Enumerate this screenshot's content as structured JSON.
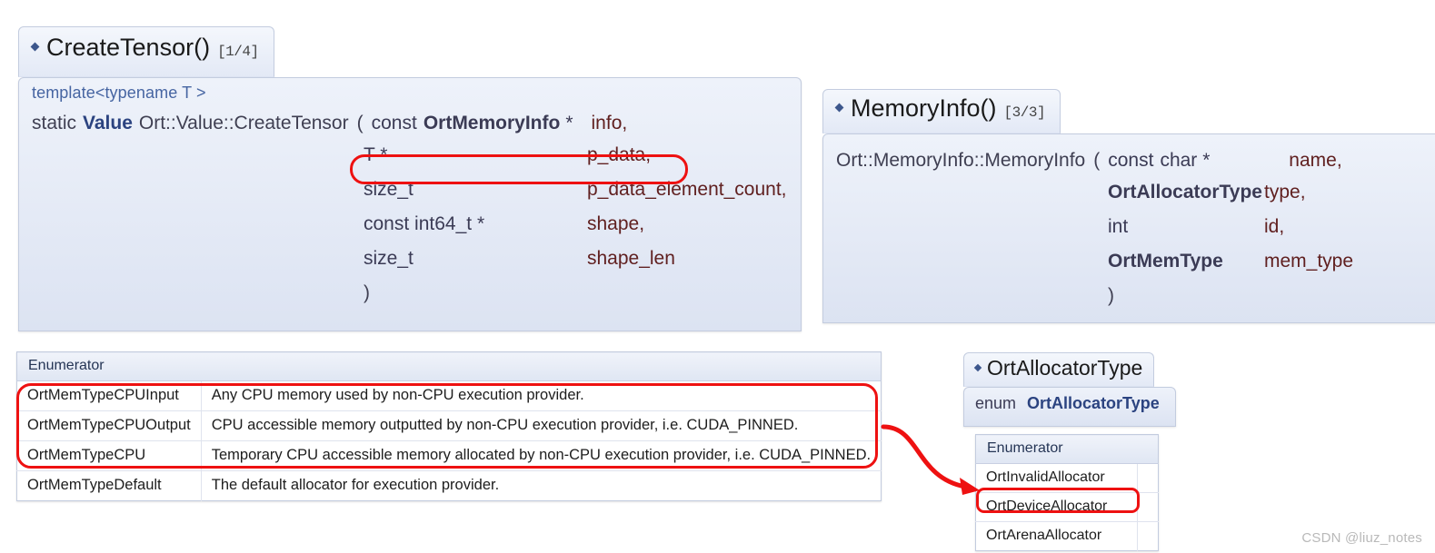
{
  "accent_colors": {
    "highlight_red": "#ee1111",
    "doxygen_blue": "#2b4380",
    "panel_body_bg": "#dfe5f2",
    "panel_header_bg": "#e3e9f6",
    "param_name_brown": "#602020"
  },
  "panels": {
    "create_tensor": {
      "title": "CreateTensor()",
      "permalink": "[1/4]",
      "template_line": "template<typename T >",
      "signature_prefix": "static",
      "return_type": "Value",
      "qualified_name": "Ort::Value::CreateTensor",
      "open_paren": "(",
      "close_paren": ")",
      "params": [
        {
          "qualifier": "const",
          "type": "OrtMemoryInfo",
          "type_bold": true,
          "ptr": "*",
          "name": "info,"
        },
        {
          "qualifier": "",
          "type": "T",
          "type_bold": false,
          "ptr": "*",
          "name": "p_data,"
        },
        {
          "qualifier": "",
          "type": "size_t",
          "type_bold": false,
          "ptr": "",
          "name": "p_data_element_count,"
        },
        {
          "qualifier": "const",
          "type": "int64_t",
          "type_bold": false,
          "ptr": "*",
          "name": "shape,"
        },
        {
          "qualifier": "",
          "type": "size_t",
          "type_bold": false,
          "ptr": "",
          "name": "shape_len"
        }
      ]
    },
    "memory_info": {
      "title": "MemoryInfo()",
      "permalink": "[3/3]",
      "qualified_name": "Ort::MemoryInfo::MemoryInfo",
      "open_paren": "(",
      "close_paren": ")",
      "params": [
        {
          "qualifier": "const",
          "type": "char",
          "type_bold": false,
          "ptr": "*",
          "name": "name,"
        },
        {
          "qualifier": "",
          "type": "OrtAllocatorType",
          "type_bold": true,
          "ptr": "",
          "name": "type,"
        },
        {
          "qualifier": "",
          "type": "int",
          "type_bold": false,
          "ptr": "",
          "name": "id,"
        },
        {
          "qualifier": "",
          "type": "OrtMemType",
          "type_bold": true,
          "ptr": "",
          "name": "mem_type"
        }
      ]
    },
    "ort_allocator_type": {
      "title": "OrtAllocatorType",
      "enum_keyword": "enum",
      "enum_name": "OrtAllocatorType"
    }
  },
  "mem_type_table": {
    "header": "Enumerator",
    "rows": [
      {
        "name": "OrtMemTypeCPUInput",
        "desc": "Any CPU memory used by non-CPU execution provider.",
        "highlighted": true
      },
      {
        "name": "OrtMemTypeCPUOutput",
        "desc": "CPU accessible memory outputted by non-CPU execution provider, i.e. CUDA_PINNED.",
        "highlighted": true
      },
      {
        "name": "OrtMemTypeCPU",
        "desc": "Temporary CPU accessible memory allocated by non-CPU execution provider, i.e. CUDA_PINNED.",
        "highlighted": true
      },
      {
        "name": "OrtMemTypeDefault",
        "desc": "The default allocator for execution provider.",
        "highlighted": false
      }
    ]
  },
  "allocator_table": {
    "header": "Enumerator",
    "rows": [
      {
        "name": "OrtInvalidAllocator",
        "highlighted": false
      },
      {
        "name": "OrtDeviceAllocator",
        "highlighted": true
      },
      {
        "name": "OrtArenaAllocator",
        "highlighted": false
      }
    ]
  },
  "annotations": {
    "p_data_box_label": "p-data-parameter-highlight",
    "mem_type_box_label": "cpu-mem-types-highlight",
    "device_allocator_box_label": "ort-device-allocator-highlight",
    "arrow_label": "mem-type-to-allocator-arrow"
  },
  "watermark": "CSDN @liuz_notes"
}
